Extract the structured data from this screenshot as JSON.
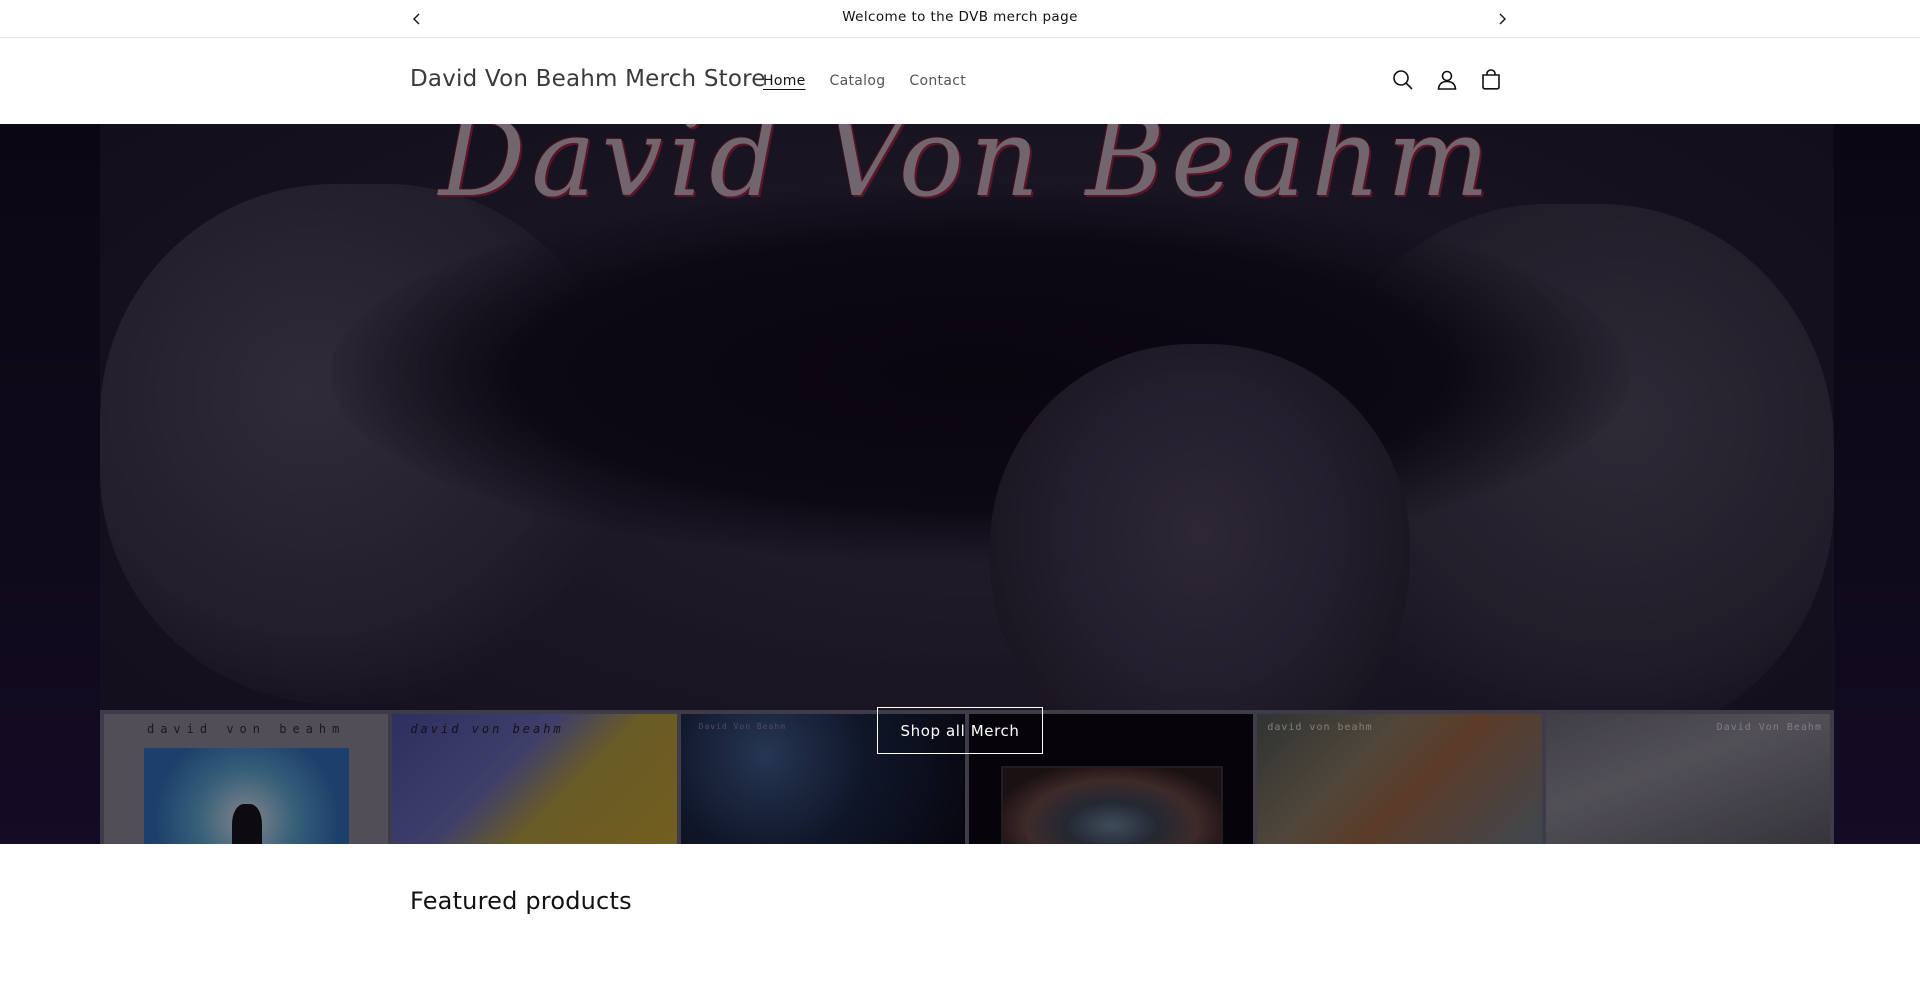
{
  "announcement": {
    "text": "Welcome to the DVB merch page",
    "prev_icon": "chevron-left-icon",
    "next_icon": "chevron-right-icon"
  },
  "header": {
    "store_name": "David Von Beahm Merch Store",
    "nav": [
      {
        "label": "Home",
        "active": true
      },
      {
        "label": "Catalog",
        "active": false
      },
      {
        "label": "Contact",
        "active": false
      }
    ],
    "icons": [
      "search-icon",
      "account-icon",
      "cart-icon"
    ]
  },
  "hero": {
    "signature": "David Von Beahm",
    "button_label": "Shop all Merch",
    "album_captions": [
      "david von beahm",
      "david von beahm",
      "David Von Beahm",
      "",
      "david von beahm",
      "David Von Beahm"
    ]
  },
  "featured": {
    "title": "Featured products"
  },
  "colors": {
    "hero_overlay": "#080510",
    "signature_accent": "#b0213a",
    "text": "#121212"
  }
}
